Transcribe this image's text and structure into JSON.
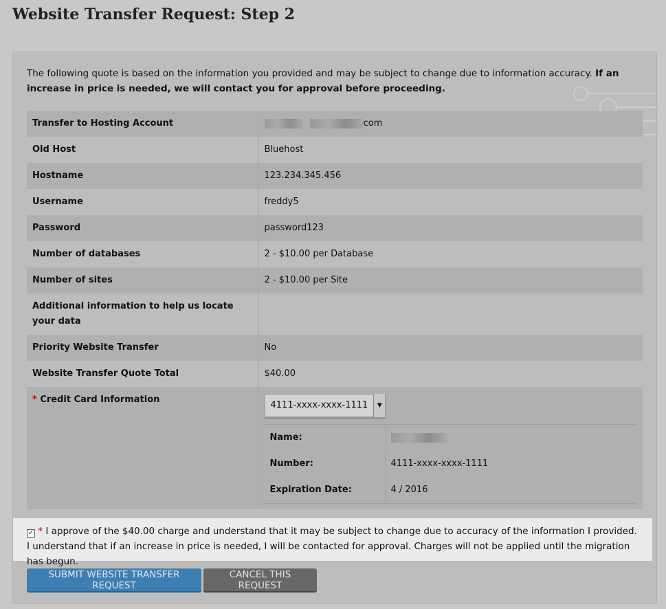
{
  "title": "Website Transfer Request: Step 2",
  "intro": {
    "text": "The following quote is based on the information you provided and may be subject to change due to information accuracy. ",
    "bold": "If an increase in price is needed, we will contact you for approval before proceeding."
  },
  "rows": [
    {
      "label": "Transfer to Hosting Account",
      "value": "com"
    },
    {
      "label": "Old Host",
      "value": "Bluehost"
    },
    {
      "label": "Hostname",
      "value": "123.234.345.456"
    },
    {
      "label": "Username",
      "value": "freddy5"
    },
    {
      "label": "Password",
      "value": "password123"
    },
    {
      "label": "Number of databases",
      "value": "2 - $10.00 per Database"
    },
    {
      "label": "Number of sites",
      "value": "2 - $10.00 per Site"
    },
    {
      "label": "Additional information to help us locate your data",
      "value": ""
    },
    {
      "label": "Priority Website Transfer",
      "value": "No"
    },
    {
      "label": "Website Transfer Quote Total",
      "value": "$40.00"
    }
  ],
  "credit": {
    "required": "*",
    "label": "Credit Card Information",
    "selected": "4111-xxxx-xxxx-1111",
    "name_label": "Name:",
    "number_label": "Number:",
    "number": "4111-xxxx-xxxx-1111",
    "exp_label": "Expiration Date:",
    "exp": "4 / 2016"
  },
  "approve": {
    "required": "*",
    "text": " I approve of the $40.00 charge and understand that it may be subject to change due to accuracy of the information I provided. I understand that if an increase in price is needed, I will be contacted for approval. Charges will not be applied until the migration has begun.",
    "checked": true
  },
  "buttons": {
    "submit": "SUBMIT WEBSITE TRANSFER REQUEST",
    "cancel": "CANCEL THIS REQUEST"
  }
}
